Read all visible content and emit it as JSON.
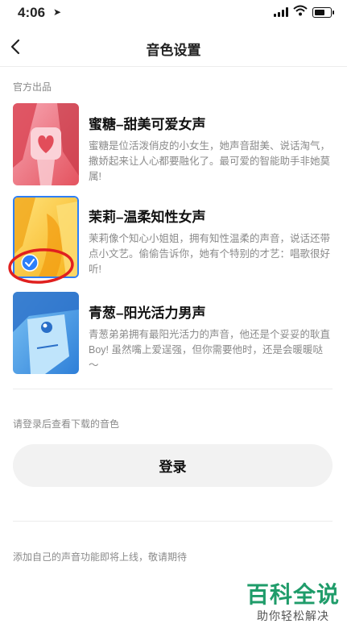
{
  "status_bar": {
    "time": "4:06"
  },
  "nav": {
    "title": "音色设置"
  },
  "official": {
    "label": "官方出品",
    "voices": [
      {
        "name": "蜜糖–甜美可爱女声",
        "desc": "蜜糖是位活泼俏皮的小女生，她声音甜美、说话淘气，撒娇起来让人心都要融化了。最可爱的智能助手非她莫属!",
        "selected": false
      },
      {
        "name": "茉莉–温柔知性女声",
        "desc": "茉莉像个知心小姐姐，拥有知性温柔的声音，说话还带点小文艺。偷偷告诉你，她有个特别的才艺：唱歌很好听!",
        "selected": true
      },
      {
        "name": "青葱–阳光活力男声",
        "desc": "青葱弟弟拥有最阳光活力的声音，他还是个妥妥的耿直Boy! 虽然嘴上爱逞强，但你需要他时，还是会暖暖哒～",
        "selected": false
      }
    ]
  },
  "downloaded": {
    "hint": "请登录后查看下载的音色",
    "login_label": "登录"
  },
  "footer": {
    "note": "添加自己的声音功能即将上线，敬请期待"
  },
  "watermark": {
    "title": "百科全说",
    "subtitle": "助你轻松解决"
  },
  "colors": {
    "selected_border": "#2d7ff9",
    "check": "#2d7ff9",
    "annotation": "#e0201f",
    "watermark": "#1f9c6a"
  }
}
